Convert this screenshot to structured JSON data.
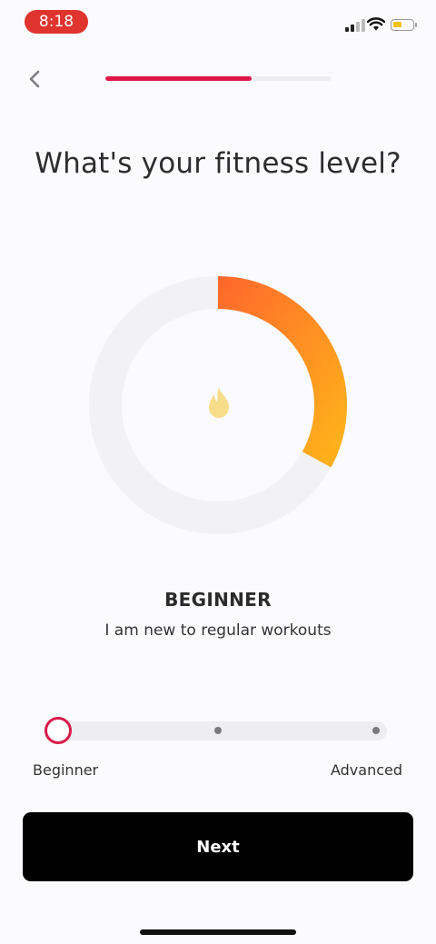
{
  "status_bar": {
    "time": "8:18",
    "time_pill_color": "#e0342e",
    "icons": [
      "cellular-signal-icon",
      "wifi-icon",
      "battery-icon"
    ]
  },
  "header": {
    "back_icon": "chevron-left-icon",
    "progress_fraction": 0.65,
    "progress_color": "#e0174a"
  },
  "title": "What's your fitness level?",
  "gauge": {
    "level_fraction": 0.33,
    "gradient_start": "#ff6a2b",
    "gradient_end": "#ffb11b",
    "center_icon": "flame-icon",
    "center_icon_color": "#f7dd8a"
  },
  "level": {
    "name": "BEGINNER",
    "description": "I am new to regular workouts"
  },
  "slider": {
    "steps": 3,
    "selected_step": 0,
    "min_label": "Beginner",
    "max_label": "Advanced",
    "accent": "#d81b4a"
  },
  "next_button": {
    "label": "Next"
  }
}
